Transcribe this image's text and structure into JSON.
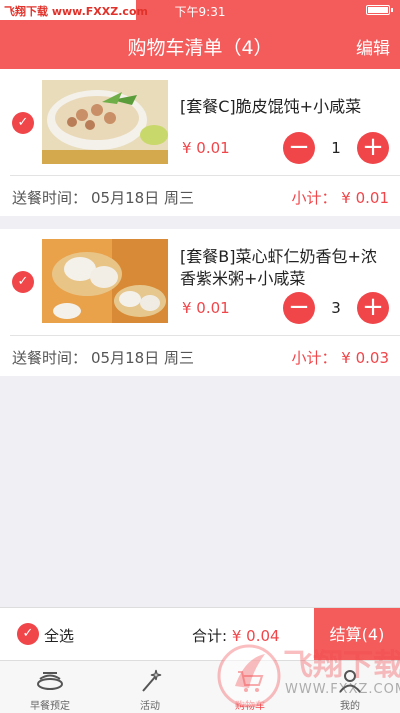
{
  "status_bar": {
    "time": "下午9:31"
  },
  "watermark_top": "飞翔下载 www.FXXZ.com",
  "nav": {
    "title": "购物车清单（4）",
    "edit_label": "编辑"
  },
  "items": [
    {
      "name": "[套餐C]脆皮馄饨+小咸菜",
      "price": "¥ 0.01",
      "quantity": "1",
      "delivery_label": "送餐时间：",
      "delivery_date": "05月18日 周三",
      "subtotal": "小计： ¥ 0.01",
      "checked": true
    },
    {
      "name": "[套餐B]菜心虾仁奶香包+浓香紫米粥+小咸菜",
      "price": "¥ 0.01",
      "quantity": "3",
      "delivery_label": "送餐时间：",
      "delivery_date": "05月18日 周三",
      "subtotal": "小计： ¥ 0.03",
      "checked": true
    }
  ],
  "footer": {
    "select_all": "全选",
    "total_label": "合计:",
    "total_value": "¥ 0.04",
    "checkout": "结算(4)"
  },
  "tabs": [
    {
      "label": "早餐预定",
      "icon": "breakfast-icon"
    },
    {
      "label": "活动",
      "icon": "magic-wand-icon"
    },
    {
      "label": "购物车",
      "icon": "cart-icon",
      "active": true
    },
    {
      "label": "我的",
      "icon": "person-icon"
    }
  ],
  "watermark_bottom": {
    "brand": "飞翔下载",
    "url": "WWW.FXXZ.COM"
  },
  "colors": {
    "accent": "#f45c5c",
    "price": "#f0464a",
    "background": "#efeff4"
  }
}
